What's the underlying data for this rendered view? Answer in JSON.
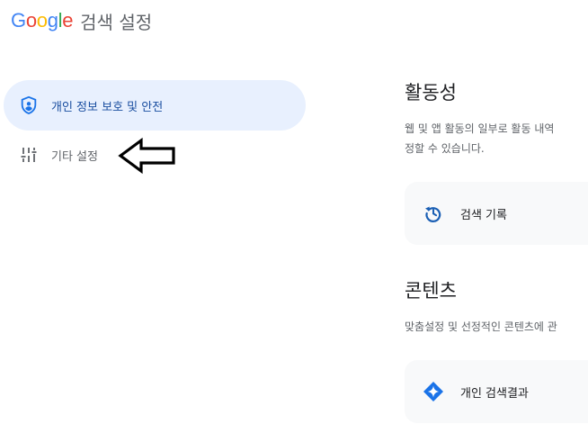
{
  "header": {
    "logo_letters": [
      "G",
      "o",
      "o",
      "g",
      "l",
      "e"
    ],
    "logo_colors": [
      "#4285F4",
      "#EA4335",
      "#FBBC05",
      "#4285F4",
      "#34A853",
      "#EA4335"
    ],
    "title": "검색 설정"
  },
  "sidebar": {
    "items": [
      {
        "label": "개인 정보 보호 및 안전",
        "icon": "shield-user-icon",
        "active": true
      },
      {
        "label": "기타 설정",
        "icon": "tune-sliders-icon",
        "active": false
      }
    ],
    "accent_color": "#1a73e8"
  },
  "main": {
    "sections": [
      {
        "title": "활동성",
        "description": "웹 및 앱 활동의 일부로 활동 내역\n정할 수 있습니다.",
        "card": {
          "label": "검색 기록",
          "icon": "history-icon"
        }
      },
      {
        "title": "콘텐츠",
        "description": "맞춤설정 및 선정적인 콘텐츠에 관",
        "card": {
          "label": "개인 검색결과",
          "icon": "sparkle-icon"
        }
      }
    ]
  },
  "annotation": {
    "type": "arrow",
    "direction": "left",
    "icon": "arrow-left-annotation"
  }
}
